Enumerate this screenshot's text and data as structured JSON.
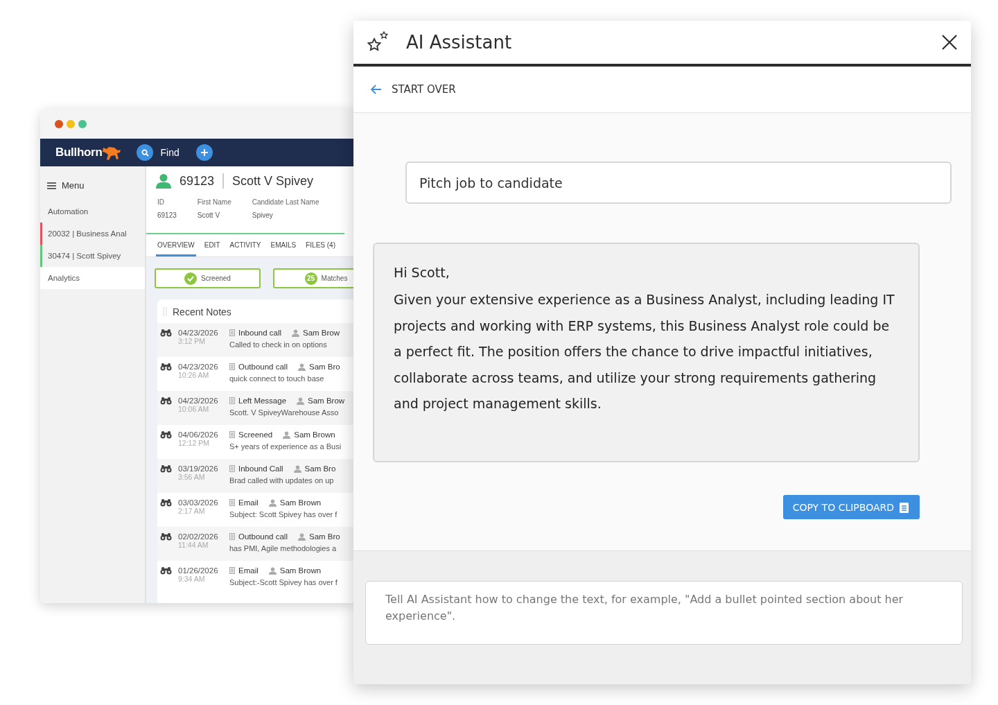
{
  "crm_window": {
    "brand": "Bullhorn",
    "find_label": "Find",
    "sidebar": {
      "menu_label": "Menu",
      "items": [
        {
          "label": "Automation",
          "selected": false
        },
        {
          "label": "20032 | Business Anal",
          "selected": false,
          "color": "#e8505b"
        },
        {
          "label": "30474 | Scott Spivey",
          "selected": false,
          "color": "#5cc97b"
        },
        {
          "label": "Analytics",
          "selected": true
        }
      ]
    },
    "record": {
      "id": "69123",
      "name": "Scott V Spivey",
      "fields": [
        {
          "label": "ID",
          "value": "69123"
        },
        {
          "label": "First Name",
          "value": "Scott V"
        },
        {
          "label": "Candidate Last Name",
          "value": "Spivey"
        }
      ]
    },
    "tabs": [
      {
        "label": "OVERVIEW",
        "selected": true
      },
      {
        "label": "EDIT",
        "selected": false
      },
      {
        "label": "ACTIVITY",
        "selected": false
      },
      {
        "label": "EMAILS",
        "selected": false
      },
      {
        "label": "FILES (4)",
        "selected": false
      }
    ],
    "steps": [
      {
        "kind": "check",
        "label": "Screened"
      },
      {
        "kind": "count",
        "count": "25",
        "label": "Matches"
      }
    ],
    "notes": {
      "title": "Recent Notes",
      "rows": [
        {
          "date": "04/23/2026",
          "time": "3:12 PM",
          "type": "Inbound call",
          "author": "Sam Brow",
          "text": "Called to check in on options"
        },
        {
          "date": "04/23/2026",
          "time": "10:26 AM",
          "type": "Outbound call",
          "author": "Sam Bro",
          "text": "quick connect to touch base"
        },
        {
          "date": "04/23/2026",
          "time": "10:06 AM",
          "type": "Left Message",
          "author": "Sam Brow",
          "text": "Scott. V SpiveyWarehouse Asso"
        },
        {
          "date": "04/06/2026",
          "time": "12:12 PM",
          "type": "Screened",
          "author": "Sam Brown",
          "text": "S+ years of experience as a Busi"
        },
        {
          "date": "03/19/2026",
          "time": "3:56 AM",
          "type": "Inbound Call",
          "author": "Sam Bro",
          "text": "Brad called with updates on up"
        },
        {
          "date": "03/03/2026",
          "time": "2:17 AM",
          "type": "Email",
          "author": "Sam Brown",
          "text": "Subject: Scott Spivey has over f"
        },
        {
          "date": "02/02/2026",
          "time": "11:44 AM",
          "type": "Outbound call",
          "author": "Sam Bro",
          "text": "has PMI, Agile methodologies a"
        },
        {
          "date": "01/26/2026",
          "time": "9:34 AM",
          "type": "Email",
          "author": "Sam Brown",
          "text": "Subject:-Scott Spivey has over f"
        }
      ]
    }
  },
  "assistant": {
    "title": "AI Assistant",
    "back_label": "START OVER",
    "prompt": "Pitch job to candidate",
    "message": {
      "greeting": "Hi Scott,",
      "body": "Given your extensive experience as a Business Analyst, including leading IT projects and working with ERP systems, this Business Analyst role could be a perfect fit. The position offers the chance to drive impactful initiatives, collaborate across teams, and utilize your strong requirements gathering and project management skills."
    },
    "copy_button": "COPY TO CLIPBOARD",
    "instruction_placeholder": "Tell AI Assistant how to change the text, for example, \"Add a bullet pointed section about her experience\"."
  }
}
